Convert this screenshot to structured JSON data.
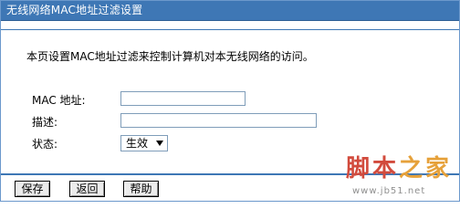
{
  "header": {
    "title": "无线网络MAC地址过滤设置"
  },
  "intro_text": "本页设置MAC地址过滤来控制计算机对本无线网络的访问。",
  "form": {
    "mac_label": "MAC 地址:",
    "mac_value": "",
    "description_label": "描述:",
    "description_value": "",
    "status_label": "状态:",
    "status_selected": "生效"
  },
  "buttons": {
    "save": "保存",
    "back": "返回",
    "help": "帮助"
  },
  "watermark": {
    "chars": [
      "脚",
      "本",
      "之",
      "家"
    ],
    "url": "www.jb51.net"
  },
  "colors": {
    "title_bar": "#3e77b5",
    "border": "#6b98cc",
    "watermark_red": "#d24b3d",
    "watermark_orange": "#e6a13a",
    "watermark_gray": "#8f8f8f"
  },
  "icons": {
    "dropdown": "chevron-down-icon"
  }
}
